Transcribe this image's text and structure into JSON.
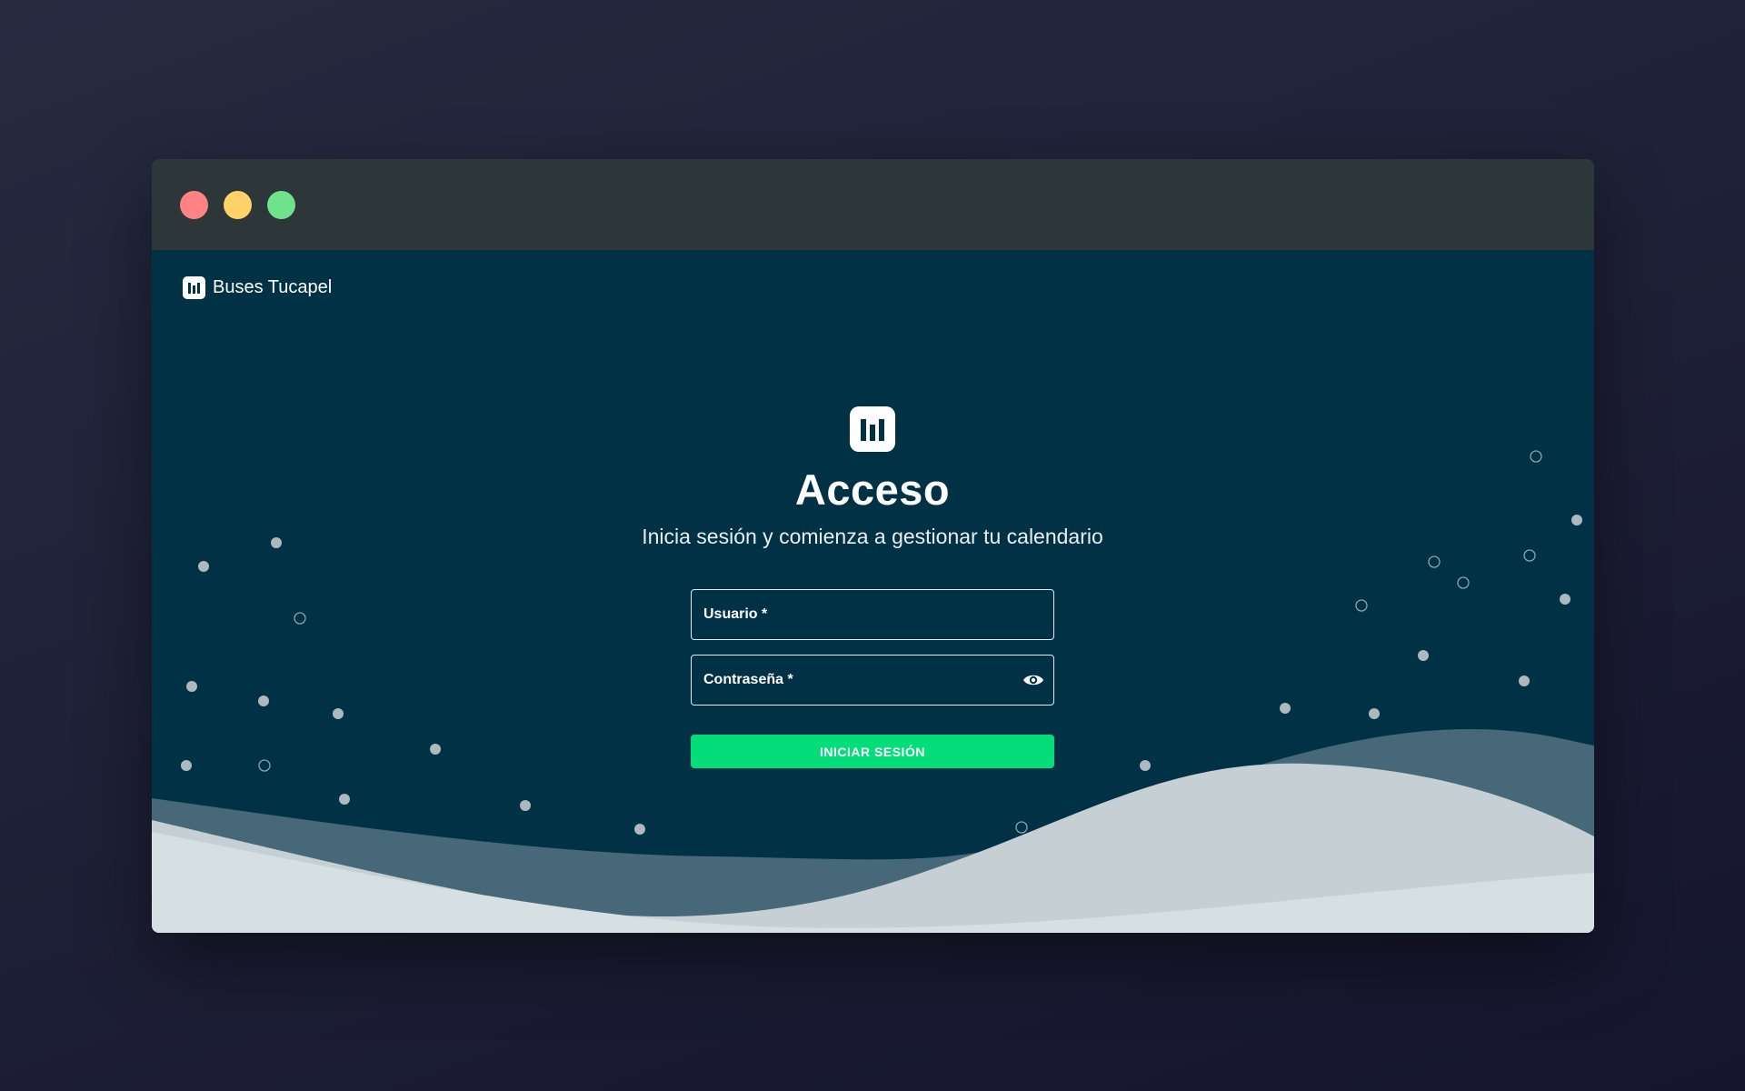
{
  "window": {
    "controls": [
      "close",
      "minimize",
      "maximize"
    ],
    "colors": {
      "close": "#ff8383",
      "minimize": "#ffd169",
      "maximize": "#6ee38c"
    }
  },
  "brand": {
    "name": "Buses Tucapel",
    "icon": "bar-chart-logo-icon"
  },
  "login": {
    "icon": "bar-chart-logo-icon",
    "title": "Acceso",
    "subtitle": "Inicia sesión y comienza a gestionar tu calendario",
    "username_label": "Usuario *",
    "password_label": "Contraseña *",
    "password_toggle_icon": "eye-icon",
    "submit_label": "INICIAR SESIÓN"
  },
  "colors": {
    "background": "#013145",
    "accent": "#05dc7a",
    "titlebar": "#2d3739"
  }
}
